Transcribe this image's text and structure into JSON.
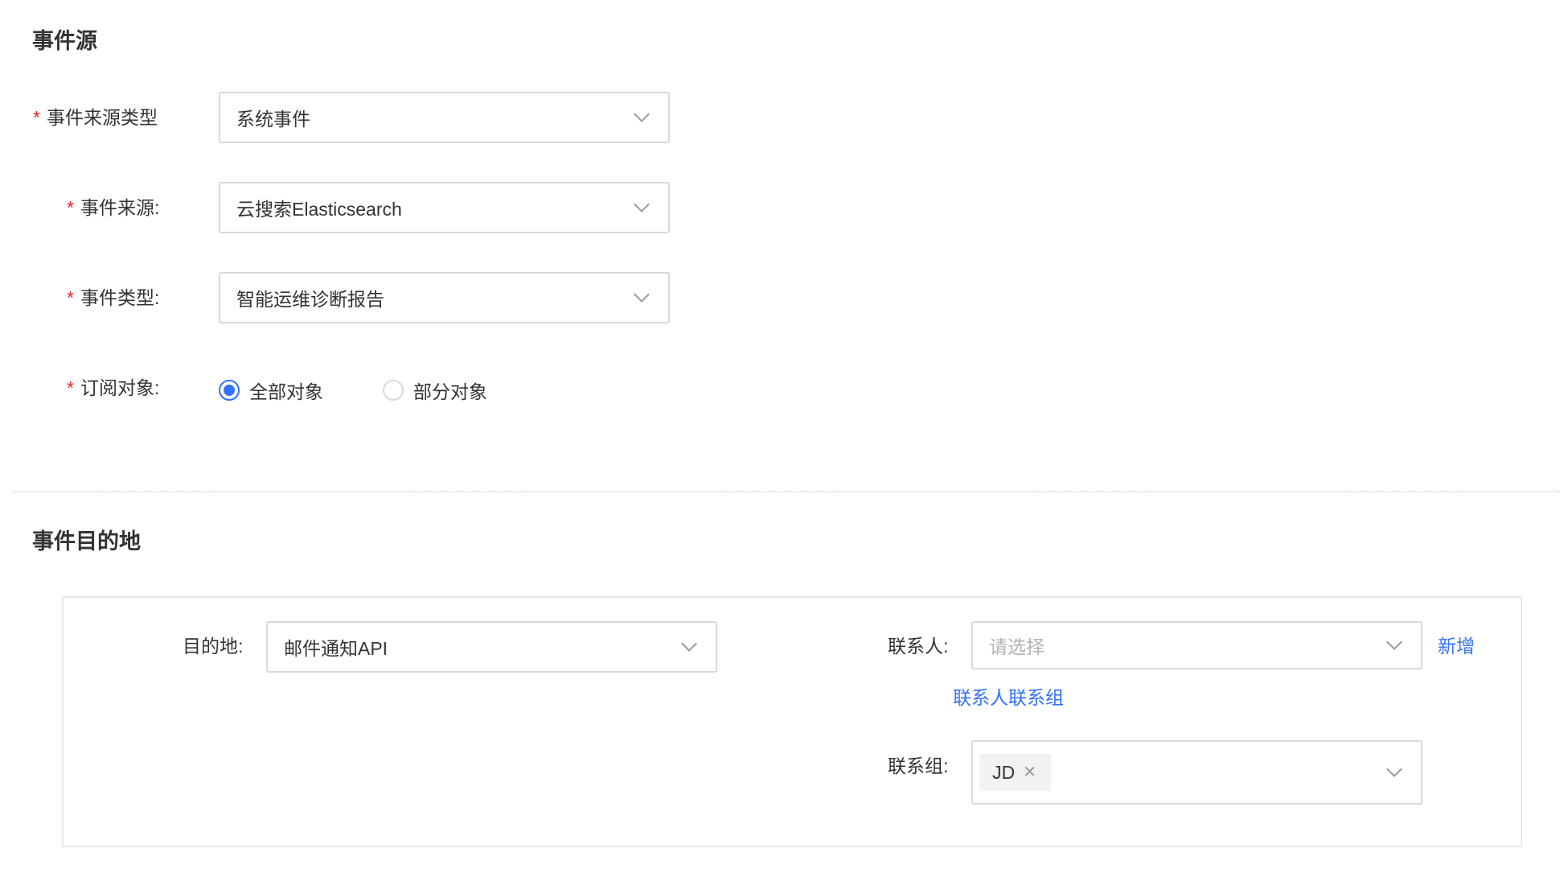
{
  "source_section": {
    "title": "事件源",
    "fields": {
      "source_type": {
        "label": "事件来源类型",
        "value": "系统事件"
      },
      "source": {
        "label": "事件来源:",
        "value": "云搜索Elasticsearch"
      },
      "event_type": {
        "label": "事件类型:",
        "value": "智能运维诊断报告"
      },
      "subscribe_target": {
        "label": "订阅对象:",
        "options": [
          "全部对象",
          "部分对象"
        ],
        "selected": "全部对象"
      }
    },
    "required_mark": "*"
  },
  "destination_section": {
    "title": "事件目的地",
    "destination": {
      "label": "目的地:",
      "value": "邮件通知API"
    },
    "contact": {
      "label": "联系人:",
      "placeholder": "请选择",
      "add_link": "新增"
    },
    "contact_group_link": "联系人联系组",
    "contact_group": {
      "label": "联系组:",
      "tags": [
        "JD"
      ]
    }
  },
  "colors": {
    "primary": "#3370ff",
    "required": "#f5222d",
    "border": "#d9d9d9"
  }
}
